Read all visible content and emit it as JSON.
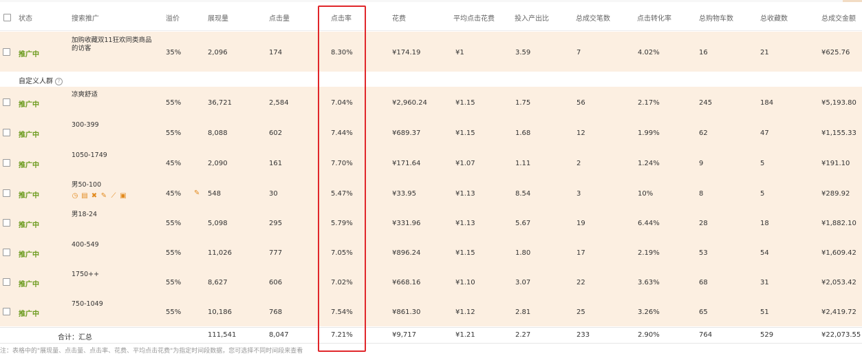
{
  "header": {
    "status": "状态",
    "keyword": "搜索推广",
    "premium": "溢价",
    "impressions": "展现量",
    "clicks": "点击量",
    "ctr": "点击率",
    "cost": "花费",
    "avg_cpc": "平均点击花费",
    "roi": "投入产出比",
    "total_orders": "总成交笔数",
    "cvr": "点击转化率",
    "cart": "总购物车数",
    "fav": "总收藏数",
    "total_gmv": "总成交金额"
  },
  "group_label": "自定义人群",
  "rows": [
    {
      "status": "推广中",
      "keyword": "加购收藏双11狂欢同类商品的访客",
      "premium": "35%",
      "impressions": "2,096",
      "clicks": "174",
      "ctr": "8.30%",
      "cost": "¥174.19",
      "avg_cpc": "¥1",
      "roi": "3.59",
      "total_orders": "7",
      "cvr": "4.02%",
      "cart": "16",
      "fav": "21",
      "total_gmv": "¥625.76"
    },
    {
      "status": "推广中",
      "keyword": "凉爽舒适",
      "premium": "55%",
      "impressions": "36,721",
      "clicks": "2,584",
      "ctr": "7.04%",
      "cost": "¥2,960.24",
      "avg_cpc": "¥1.15",
      "roi": "1.75",
      "total_orders": "56",
      "cvr": "2.17%",
      "cart": "245",
      "fav": "184",
      "total_gmv": "¥5,193.80"
    },
    {
      "status": "推广中",
      "keyword": "300-399",
      "premium": "55%",
      "impressions": "8,088",
      "clicks": "602",
      "ctr": "7.44%",
      "cost": "¥689.37",
      "avg_cpc": "¥1.15",
      "roi": "1.68",
      "total_orders": "12",
      "cvr": "1.99%",
      "cart": "62",
      "fav": "47",
      "total_gmv": "¥1,155.33"
    },
    {
      "status": "推广中",
      "keyword": "1050-1749",
      "premium": "45%",
      "impressions": "2,090",
      "clicks": "161",
      "ctr": "7.70%",
      "cost": "¥171.64",
      "avg_cpc": "¥1.07",
      "roi": "1.11",
      "total_orders": "2",
      "cvr": "1.24%",
      "cart": "9",
      "fav": "5",
      "total_gmv": "¥191.10"
    },
    {
      "status": "推广中",
      "keyword": "男50-100",
      "premium": "45%",
      "impressions": "548",
      "clicks": "30",
      "ctr": "5.47%",
      "cost": "¥33.95",
      "avg_cpc": "¥1.13",
      "roi": "8.54",
      "total_orders": "3",
      "cvr": "10%",
      "cart": "8",
      "fav": "5",
      "total_gmv": "¥289.92"
    },
    {
      "status": "推广中",
      "keyword": "男18-24",
      "premium": "55%",
      "impressions": "5,098",
      "clicks": "295",
      "ctr": "5.79%",
      "cost": "¥331.96",
      "avg_cpc": "¥1.13",
      "roi": "5.67",
      "total_orders": "19",
      "cvr": "6.44%",
      "cart": "28",
      "fav": "18",
      "total_gmv": "¥1,882.10"
    },
    {
      "status": "推广中",
      "keyword": "400-549",
      "premium": "55%",
      "impressions": "11,026",
      "clicks": "777",
      "ctr": "7.05%",
      "cost": "¥896.24",
      "avg_cpc": "¥1.15",
      "roi": "1.80",
      "total_orders": "17",
      "cvr": "2.19%",
      "cart": "53",
      "fav": "54",
      "total_gmv": "¥1,609.42"
    },
    {
      "status": "推广中",
      "keyword": "1750++",
      "premium": "55%",
      "impressions": "8,627",
      "clicks": "606",
      "ctr": "7.02%",
      "cost": "¥668.16",
      "avg_cpc": "¥1.10",
      "roi": "3.07",
      "total_orders": "22",
      "cvr": "3.63%",
      "cart": "68",
      "fav": "31",
      "total_gmv": "¥2,053.42"
    },
    {
      "status": "推广中",
      "keyword": "750-1049",
      "premium": "55%",
      "impressions": "10,186",
      "clicks": "768",
      "ctr": "7.54%",
      "cost": "¥861.30",
      "avg_cpc": "¥1.12",
      "roi": "2.81",
      "total_orders": "25",
      "cvr": "3.26%",
      "cart": "65",
      "fav": "51",
      "total_gmv": "¥2,419.72"
    }
  ],
  "footer": {
    "label": "合计：汇总",
    "impressions": "111,541",
    "clicks": "8,047",
    "ctr": "7.21%",
    "cost": "¥9,717",
    "avg_cpc": "¥1.21",
    "roi": "2.27",
    "total_orders": "233",
    "cvr": "2.90%",
    "cart": "764",
    "fav": "529",
    "total_gmv": "¥22,073.55"
  },
  "note": "注：表格中的\"展现量、点击量、点击率、花费、平均点击花费\"为指定时间段数据，您可选择不同时间段来查看",
  "row_icons": [
    "clock-icon",
    "clipboard-icon",
    "trash-icon",
    "pencil-icon",
    "chart-icon",
    "report-icon"
  ],
  "colors": {
    "status_green": "#6a9a1c",
    "row_bg": "#fcefe1",
    "highlight_red": "#e0262a",
    "icon_orange": "#e28a1e"
  }
}
